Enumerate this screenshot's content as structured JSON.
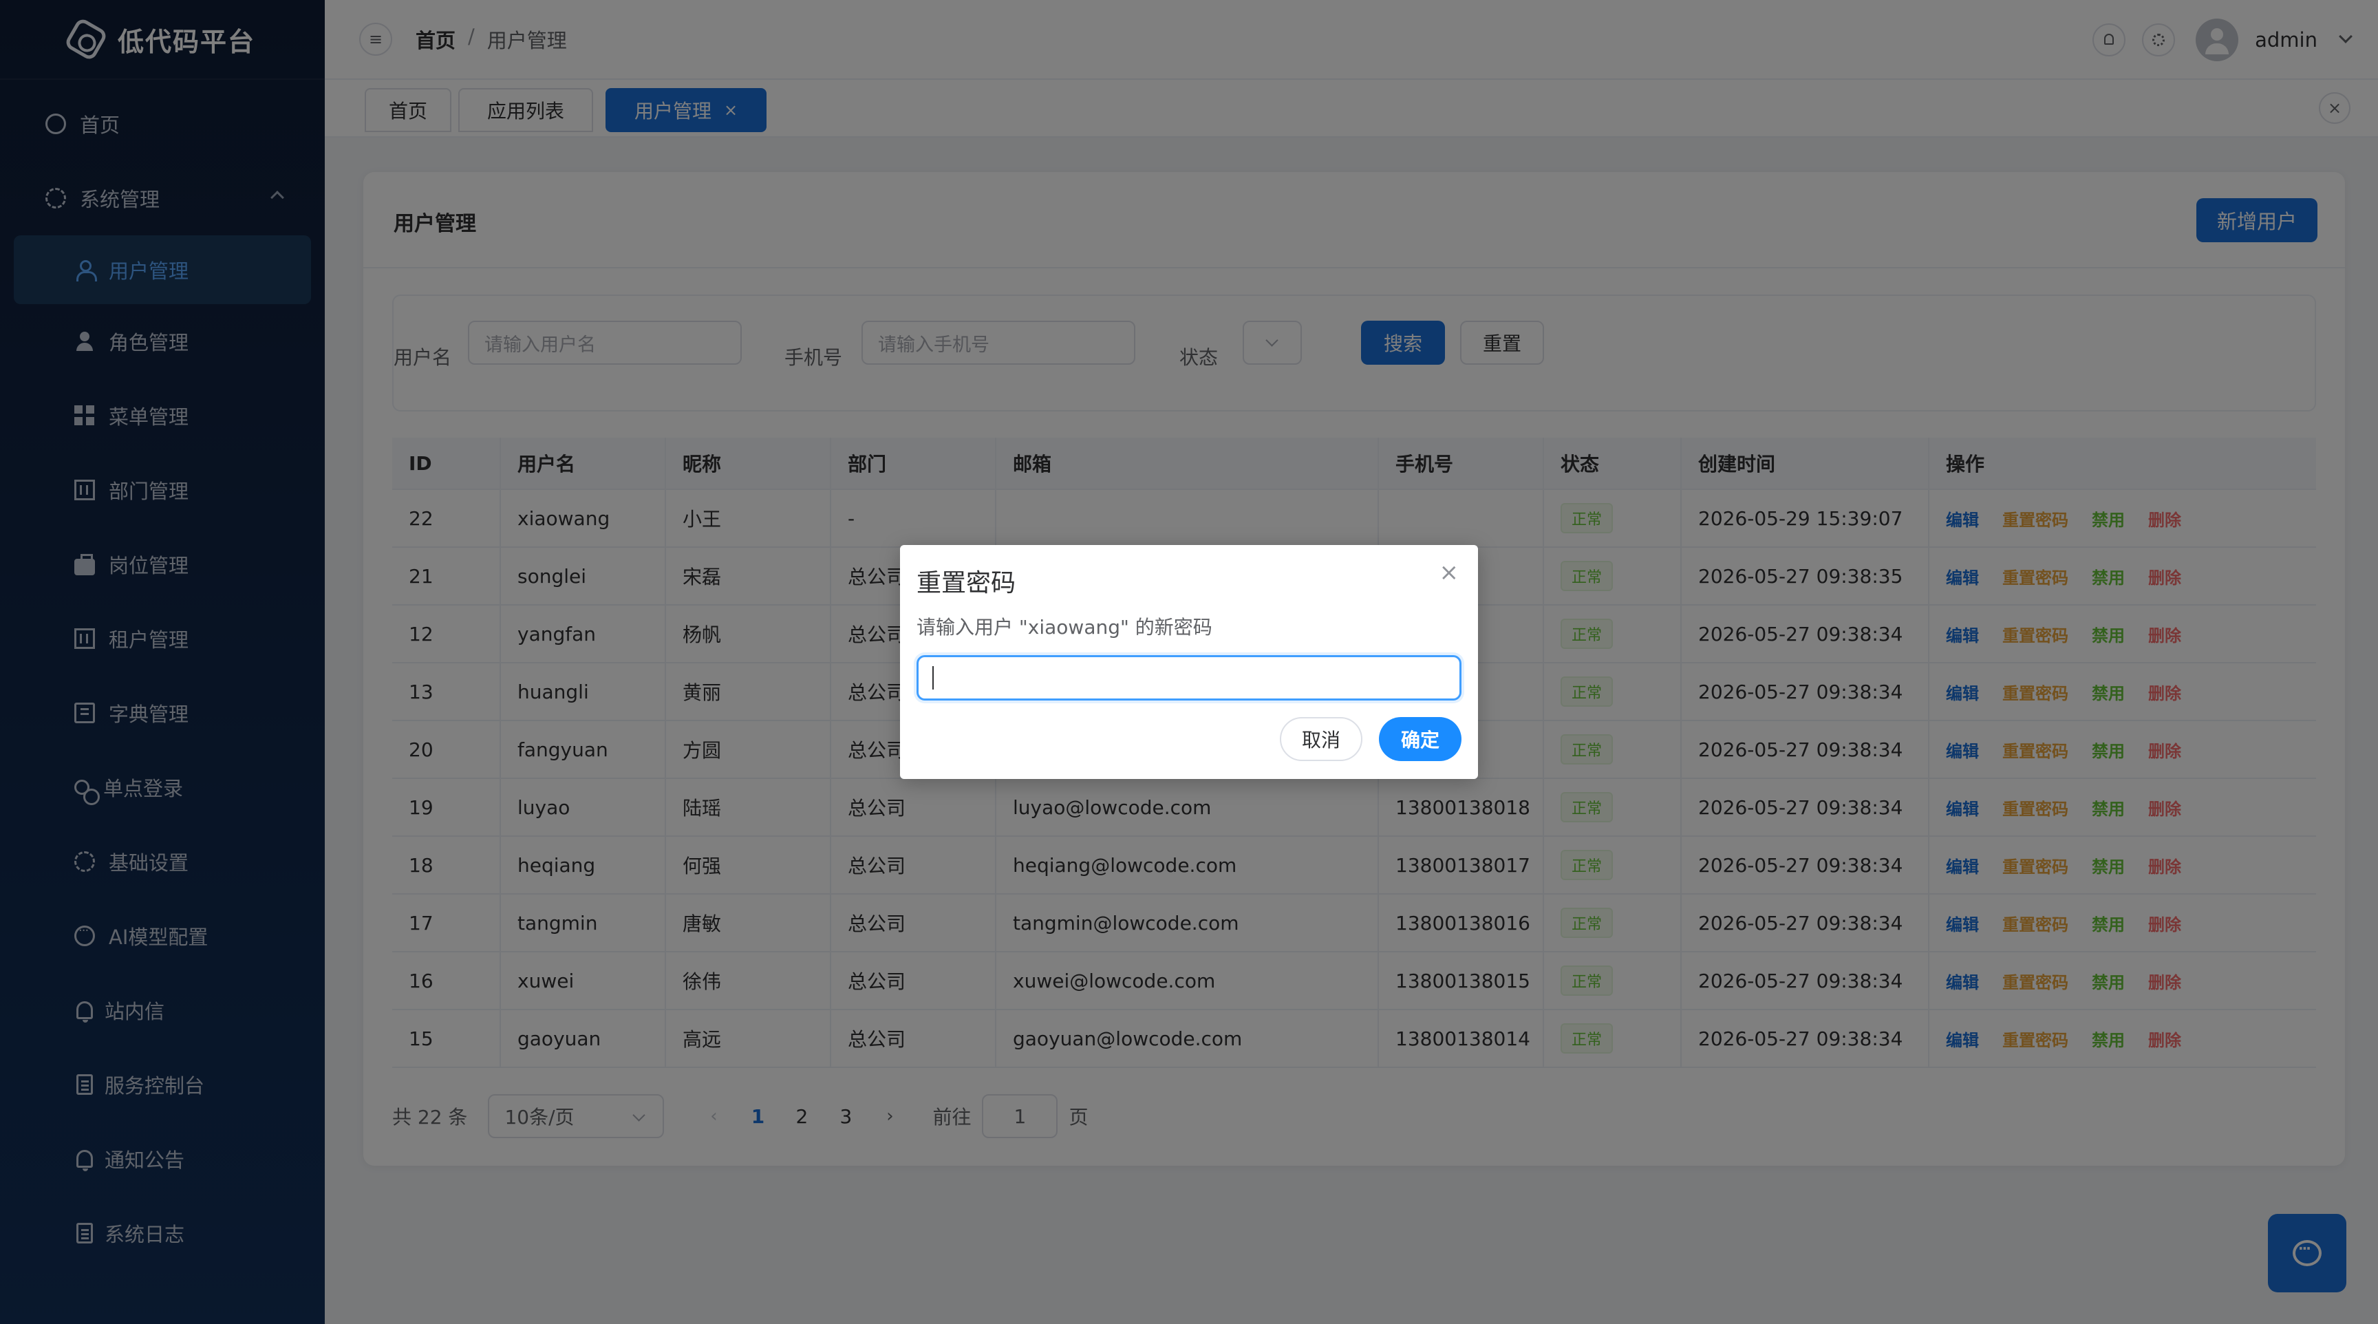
{
  "app": {
    "title": "低代码平台"
  },
  "sidebar": {
    "items": [
      {
        "label": "首页",
        "icon": "dashboard-icon"
      },
      {
        "label": "系统管理",
        "icon": "gear-icon",
        "expanded": true
      },
      {
        "label": "用户管理",
        "icon": "user-icon",
        "active": true
      },
      {
        "label": "角色管理",
        "icon": "person-icon"
      },
      {
        "label": "菜单管理",
        "icon": "grid-icon"
      },
      {
        "label": "部门管理",
        "icon": "building-icon"
      },
      {
        "label": "岗位管理",
        "icon": "briefcase-icon"
      },
      {
        "label": "租户管理",
        "icon": "building-icon"
      },
      {
        "label": "字典管理",
        "icon": "book-icon"
      },
      {
        "label": "单点登录",
        "icon": "link-icon"
      },
      {
        "label": "基础设置",
        "icon": "gear-icon"
      },
      {
        "label": "AI模型配置",
        "icon": "chat-icon"
      },
      {
        "label": "站内信",
        "icon": "bell-icon"
      },
      {
        "label": "服务控制台",
        "icon": "document-icon"
      },
      {
        "label": "通知公告",
        "icon": "bell-icon"
      },
      {
        "label": "系统日志",
        "icon": "document-icon"
      }
    ]
  },
  "header": {
    "breadcrumb": {
      "home": "首页",
      "separator": "/",
      "current": "用户管理"
    },
    "username": "admin"
  },
  "tabs": [
    {
      "label": "首页"
    },
    {
      "label": "应用列表"
    },
    {
      "label": "用户管理",
      "active": true,
      "close": "×"
    }
  ],
  "card": {
    "title": "用户管理",
    "add_button": "新增用户"
  },
  "search": {
    "username_label": "用户名",
    "username_placeholder": "请输入用户名",
    "phone_label": "手机号",
    "phone_placeholder": "请输入手机号",
    "status_label": "状态",
    "search_button": "搜索",
    "reset_button": "重置"
  },
  "table": {
    "headers": [
      "ID",
      "用户名",
      "昵称",
      "部门",
      "邮箱",
      "手机号",
      "状态",
      "创建时间",
      "操作"
    ],
    "ops": {
      "edit": "编辑",
      "reset_pwd": "重置密码",
      "disable": "禁用",
      "delete": "删除"
    },
    "rows": [
      {
        "id": "22",
        "username": "xiaowang",
        "nickname": "小王",
        "dept": "-",
        "email": "",
        "phone": "",
        "status": "正常",
        "created": "2026-05-29 15:39:07"
      },
      {
        "id": "21",
        "username": "songlei",
        "nickname": "宋磊",
        "dept": "总公司",
        "email": "",
        "phone": "3020",
        "status": "正常",
        "created": "2026-05-27 09:38:35"
      },
      {
        "id": "12",
        "username": "yangfan",
        "nickname": "杨帆",
        "dept": "总公司",
        "email": "",
        "phone": "3011",
        "status": "正常",
        "created": "2026-05-27 09:38:34"
      },
      {
        "id": "13",
        "username": "huangli",
        "nickname": "黄丽",
        "dept": "总公司",
        "email": "",
        "phone": "3012",
        "status": "正常",
        "created": "2026-05-27 09:38:34"
      },
      {
        "id": "20",
        "username": "fangyuan",
        "nickname": "方圆",
        "dept": "总公司",
        "email": "",
        "phone": "3019",
        "status": "正常",
        "created": "2026-05-27 09:38:34"
      },
      {
        "id": "19",
        "username": "luyao",
        "nickname": "陆瑶",
        "dept": "总公司",
        "email": "luyao@lowcode.com",
        "phone": "13800138018",
        "status": "正常",
        "created": "2026-05-27 09:38:34"
      },
      {
        "id": "18",
        "username": "heqiang",
        "nickname": "何强",
        "dept": "总公司",
        "email": "heqiang@lowcode.com",
        "phone": "13800138017",
        "status": "正常",
        "created": "2026-05-27 09:38:34"
      },
      {
        "id": "17",
        "username": "tangmin",
        "nickname": "唐敏",
        "dept": "总公司",
        "email": "tangmin@lowcode.com",
        "phone": "13800138016",
        "status": "正常",
        "created": "2026-05-27 09:38:34"
      },
      {
        "id": "16",
        "username": "xuwei",
        "nickname": "徐伟",
        "dept": "总公司",
        "email": "xuwei@lowcode.com",
        "phone": "13800138015",
        "status": "正常",
        "created": "2026-05-27 09:38:34"
      },
      {
        "id": "15",
        "username": "gaoyuan",
        "nickname": "高远",
        "dept": "总公司",
        "email": "gaoyuan@lowcode.com",
        "phone": "13800138014",
        "status": "正常",
        "created": "2026-05-27 09:38:34"
      }
    ]
  },
  "pagination": {
    "total": "共 22 条",
    "page_size": "10条/页",
    "pages": [
      "1",
      "2",
      "3"
    ],
    "current": "1",
    "goto_label": "前往",
    "goto_value": "1",
    "page_suffix": "页"
  },
  "dialog": {
    "title": "重置密码",
    "message": "请输入用户 \"xiaowang\" 的新密码",
    "input_value": "",
    "cancel": "取消",
    "confirm": "确定"
  },
  "colors": {
    "sidebar_bg": "#0f1d36",
    "primary": "#1a6fd6",
    "status_ok": "#67c23a",
    "warning": "#e6a23c",
    "danger": "#f56c6c"
  }
}
